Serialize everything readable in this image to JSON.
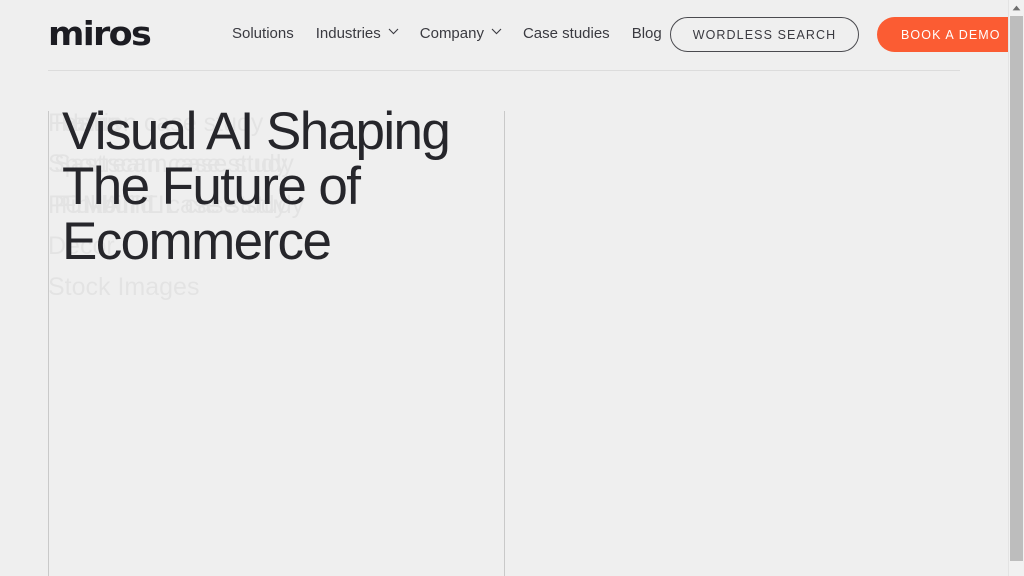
{
  "theme": {
    "background": "#efefef",
    "text": "#26262b",
    "accent_orange": "#fb5c33",
    "rule": "#dcdcdc",
    "vertical_rule": "#c9c9c9"
  },
  "header": {
    "logo": "miros",
    "nav": [
      {
        "label": "Solutions",
        "has_chevron": false,
        "icon": ""
      },
      {
        "label": "Industries",
        "has_chevron": true,
        "icon": "chevron-down-icon"
      },
      {
        "label": "Company",
        "has_chevron": true,
        "icon": "chevron-down-icon"
      },
      {
        "label": "Case studies",
        "has_chevron": false,
        "icon": ""
      },
      {
        "label": "Blog",
        "has_chevron": false,
        "icon": ""
      }
    ],
    "wordless_search_label": "WORDLESS SEARCH",
    "book_demo_label": "BOOK A DEMO"
  },
  "hero": {
    "heading_lines": [
      "Visual AI Shaping",
      "The Future of",
      "Ecommerce"
    ],
    "ghost_items": [
      {
        "primary": "Fashion case study",
        "secondary": "Ramu",
        "tertiary": "Haus"
      },
      {
        "primary": "Sportscam case study",
        "secondary": "Sastream case study",
        "tertiary": ""
      },
      {
        "primary": "PUMA TIL case study",
        "secondary": "Pinkbin TIL case study",
        "tertiary": "Fullbuild"
      },
      {
        "primary": "Decor",
        "secondary": "",
        "tertiary": ""
      },
      {
        "primary": "Stock Images",
        "secondary": "",
        "tertiary": ""
      }
    ]
  },
  "scrollbar": {
    "up_arrow": "scroll-up-arrow-icon",
    "thumb": "scroll-thumb"
  }
}
